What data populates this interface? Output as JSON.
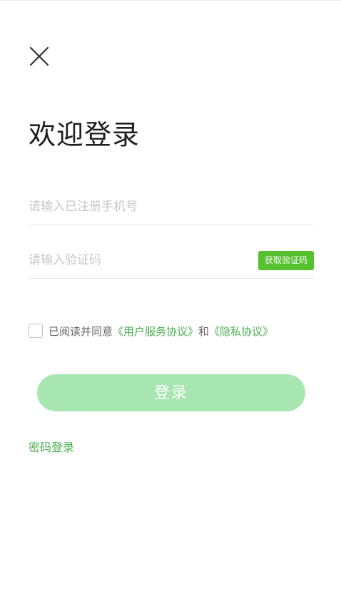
{
  "header": {
    "close_icon": "close-icon",
    "title": "欢迎登录"
  },
  "form": {
    "phone": {
      "value": "",
      "placeholder": "请输入已注册手机号"
    },
    "code": {
      "value": "",
      "placeholder": "请输入验证码",
      "get_code_label": "获取验证码"
    }
  },
  "agreement": {
    "checked": false,
    "prefix": "已阅读并同意",
    "user_agreement": "《用户服务协议》",
    "conjunction": "和",
    "privacy_policy": "《隐私协议》"
  },
  "actions": {
    "login_label": "登录",
    "password_login_label": "密码登录"
  },
  "colors": {
    "accent": "#56c02f",
    "link": "#4caf50",
    "login_button_disabled": "#a8e6b1",
    "placeholder": "#c8c8c8",
    "divider": "#e8e8e8"
  }
}
